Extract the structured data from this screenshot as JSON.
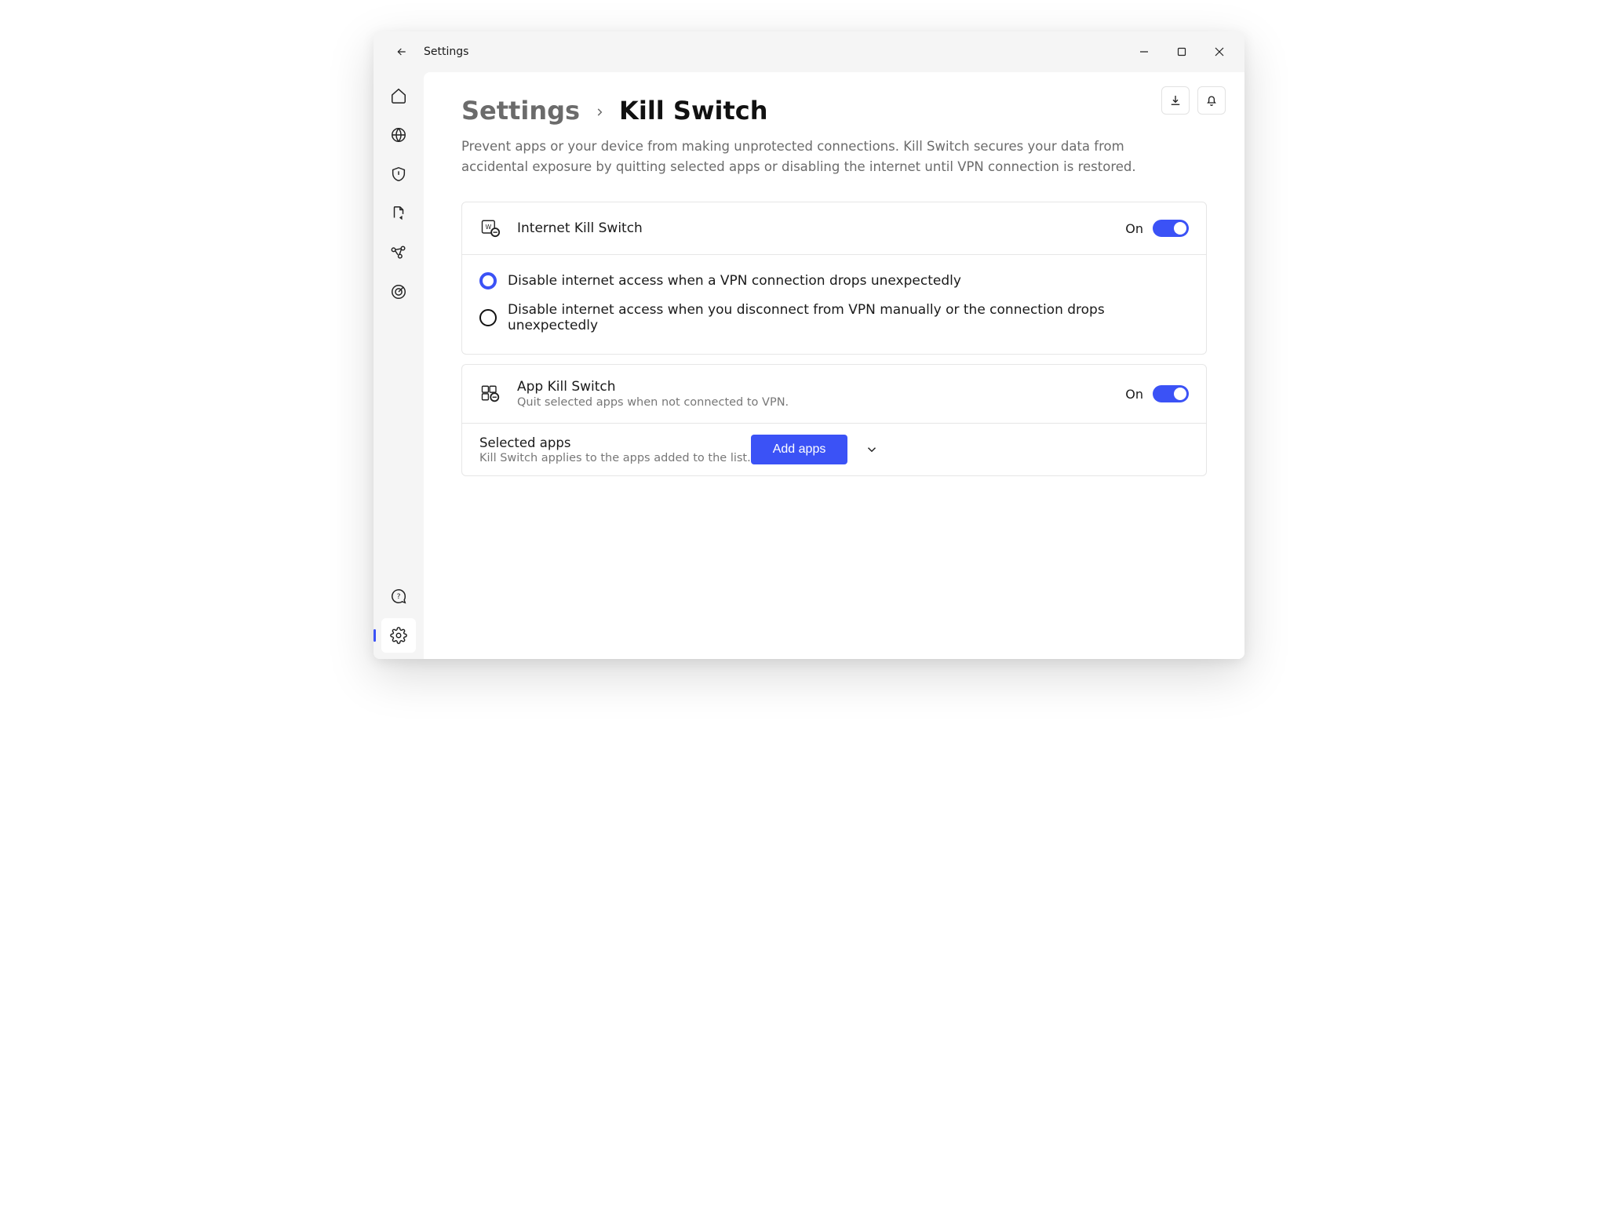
{
  "titlebar": {
    "title": "Settings"
  },
  "breadcrumb": {
    "parent": "Settings",
    "current": "Kill Switch"
  },
  "description": "Prevent apps or your device from making unprotected connections. Kill Switch secures your data from accidental exposure by quitting selected apps or disabling the internet until VPN connection is restored.",
  "internetKillSwitch": {
    "title": "Internet Kill Switch",
    "state": "On",
    "options": {
      "opt1": "Disable internet access when a VPN connection drops unexpectedly",
      "opt2": "Disable internet access when you disconnect from VPN manually or the connection drops unexpectedly"
    }
  },
  "appKillSwitch": {
    "title": "App Kill Switch",
    "subtitle": "Quit selected apps when not connected to VPN.",
    "state": "On",
    "selected": {
      "title": "Selected apps",
      "subtitle": "Kill Switch applies to the apps added to the list.",
      "button": "Add apps"
    }
  }
}
